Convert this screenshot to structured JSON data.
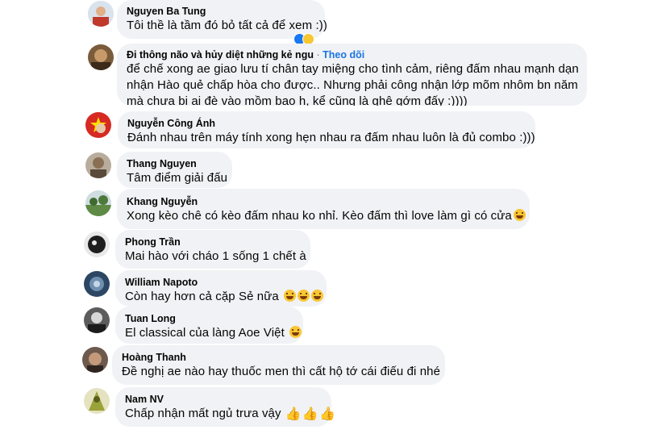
{
  "comments": [
    {
      "name": "Nguyen Ba Tung",
      "text": "Tôi thề là tầm đó bỏ tất cả để xem :))",
      "avatar_color": "#8aa7c4"
    },
    {
      "name": "Đi thông não và hủy diệt những kẻ ngu",
      "follow": "Theo dõi",
      "dot": "·",
      "lines": [
        "để chế xong ae giao lưu tí chân tay miệng cho tình cảm, riêng đấm nhau mạnh dạn",
        "nhận Hào quẻ chấp hòa cho được.. Nhưng phải công nhận lớp mõm nhôm bn năm",
        "mà chưa bị ai đè vào mồm bao h, kể cũng là ghê gớm đấy :))))"
      ],
      "avatar_color": "#6b4f2a"
    },
    {
      "name": "Nguyễn Công Ánh",
      "text": "Đánh nhau trên máy tính xong hẹn nhau ra đấm nhau luôn là đủ combo :)))",
      "avatar_color": "#d0312d"
    },
    {
      "name": "Thang Nguyen",
      "text": "Tâm điểm giải đấu",
      "avatar_color": "#9c8f7d"
    },
    {
      "name": "Khang Nguyễn",
      "text": "Xong kèo chê có kèo đấm nhau ko nhỉ. Kèo đấm thì love làm gì có cửa",
      "avatar_color": "#6f8f5a"
    },
    {
      "name": "Phong Trần",
      "text": "Mai hào với cháo 1 sống 1 chết à",
      "avatar_color": "#2b2b2b"
    },
    {
      "name": "William Napoto",
      "text": "Còn hay hơn cả cặp Sẻ nữa",
      "avatar_color": "#3c5a7a"
    },
    {
      "name": "Tuan Long",
      "text": "El classical của làng Aoe Việt",
      "avatar_color": "#3a3a3a"
    },
    {
      "name": "Hoàng Thanh",
      "text": "Đề nghị ae nào hay thuốc men thì cất hộ tớ cái điếu đi nhé",
      "avatar_color": "#5a4a40"
    },
    {
      "name": "Nam NV",
      "text": "Chấp nhận mất ngủ trưa vậy",
      "avatar_color": "#8c8f2a"
    }
  ],
  "icons": {
    "like": "like-reaction-icon",
    "haha": "haha-reaction-icon",
    "laugh": "rofl-emoji-icon",
    "thumbs": "thumbs-up-emoji-icon"
  }
}
